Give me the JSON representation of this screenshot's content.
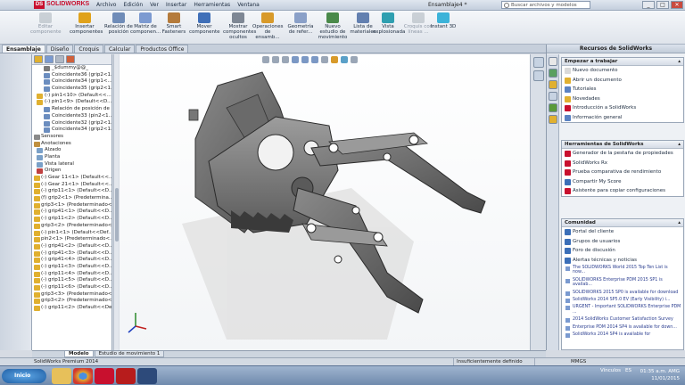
{
  "titlebar": {
    "logo": "SOLIDWORKS",
    "menu": [
      "Archivo",
      "Edición",
      "Ver",
      "Insertar",
      "Herramientas",
      "Ventana"
    ],
    "doc_title": "Ensamblaje4 *",
    "search_placeholder": "Buscar archivos y modelos",
    "win_min": "_",
    "win_max": "□",
    "win_close": "✕"
  },
  "commands": [
    {
      "label": "Editar componente",
      "color": "#9aa3ae",
      "dim": true
    },
    {
      "label": "Insertar componentes",
      "color": "#e0a21b",
      "dim": false
    },
    {
      "label": "Relación de posición",
      "color": "#6f8cb8",
      "dim": false
    },
    {
      "label": "Matriz de componen...",
      "color": "#7c9ad1",
      "dim": false
    },
    {
      "label": "Smart Fasteners",
      "color": "#b57b3b",
      "dim": false
    },
    {
      "label": "Mover componente",
      "color": "#3f6fb8",
      "dim": false
    },
    {
      "label": "Mostrar componentes ocultos",
      "color": "#7e8794",
      "dim": false
    },
    {
      "label": "Operaciones de ensamb...",
      "color": "#d89a2a",
      "dim": false
    },
    {
      "label": "Geometría de refer...",
      "color": "#8aa0c8",
      "dim": false
    },
    {
      "label": "Nuevo estudio de movimiento",
      "color": "#4a8a4a",
      "dim": false
    },
    {
      "label": "Lista de materiales",
      "color": "#6380b0",
      "dim": false
    },
    {
      "label": "Vista explosionada",
      "color": "#2f9fb0",
      "dim": false
    },
    {
      "label": "Croquis con líneas ...",
      "color": "#9aa3ae",
      "dim": true
    },
    {
      "label": "Instant 3D",
      "color": "#3bb3d9",
      "dim": false
    }
  ],
  "tabs": [
    "Ensamblaje",
    "Diseño",
    "Croquis",
    "Calcular",
    "Productos Office"
  ],
  "tree": [
    {
      "label": "_$dummy@@_",
      "lvl": "l2",
      "color": "#7b7b7b"
    },
    {
      "label": "Coincidente36 (grip2<1...",
      "lvl": "l2",
      "color": "#6b8dbf"
    },
    {
      "label": "Coincidente34 (grip1<...",
      "lvl": "l2",
      "color": "#6b8dbf"
    },
    {
      "label": "Coincidente35 (grip2<1...",
      "lvl": "l2",
      "color": "#6b8dbf"
    },
    {
      "label": "(-) pin1<10> (Default<<...",
      "lvl": "",
      "color": "#e0b030"
    },
    {
      "label": "(-) pin1<9> (Default<<D...",
      "lvl": "",
      "color": "#e0b030"
    },
    {
      "label": "Relación de posición de ...",
      "lvl": "l2",
      "color": "#6b8dbf"
    },
    {
      "label": "Coincidente33 (pin2<1...",
      "lvl": "l2",
      "color": "#6b8dbf"
    },
    {
      "label": "Coincidente32 (grip2<1...",
      "lvl": "l2",
      "color": "#6b8dbf"
    },
    {
      "label": "Coincidente34 (grip2<1...",
      "lvl": "l2",
      "color": "#6b8dbf"
    },
    {
      "label": "Sensores",
      "lvl": "l0",
      "color": "#8a8a8a"
    },
    {
      "label": "Anotaciones",
      "lvl": "l0",
      "color": "#c09040"
    },
    {
      "label": "Alzado",
      "lvl": "",
      "color": "#7aa0c8"
    },
    {
      "label": "Planta",
      "lvl": "",
      "color": "#7aa0c8"
    },
    {
      "label": "Vista lateral",
      "lvl": "",
      "color": "#7aa0c8"
    },
    {
      "label": "Origen",
      "lvl": "",
      "color": "#c04040"
    },
    {
      "label": "(-) Gear 11<1> (Default<<...",
      "lvl": "l0",
      "color": "#e0b030"
    },
    {
      "label": "(-) Gear 21<1> (Default<<...",
      "lvl": "l0",
      "color": "#e0b030"
    },
    {
      "label": "(-) grip11<1> (Default<<D...",
      "lvl": "l0",
      "color": "#e0b030"
    },
    {
      "label": "(f) grip2<1> (Predetermina...",
      "lvl": "l0",
      "color": "#e0b030"
    },
    {
      "label": "grip3<1> (Predeterminado<...",
      "lvl": "l0",
      "color": "#e0b030"
    },
    {
      "label": "(-) grip41<1> (Default<<D...",
      "lvl": "l0",
      "color": "#e0b030"
    },
    {
      "label": "(-) grip11<2> (Default<<D...",
      "lvl": "l0",
      "color": "#e0b030"
    },
    {
      "label": "grip3<2> (Predeterminado<...",
      "lvl": "l0",
      "color": "#e0b030"
    },
    {
      "label": "(-) pin1<1> (Default<<Def...",
      "lvl": "l0",
      "color": "#e0b030"
    },
    {
      "label": "pin2<1> (Predeterminado<...",
      "lvl": "l0",
      "color": "#e0b030"
    },
    {
      "label": "(-) grip41<2> (Default<<D...",
      "lvl": "l0",
      "color": "#e0b030"
    },
    {
      "label": "(-) grip41<3> (Default<<D...",
      "lvl": "l0",
      "color": "#e0b030"
    },
    {
      "label": "(-) grip41<4> (Default<<D...",
      "lvl": "l0",
      "color": "#e0b030"
    },
    {
      "label": "(-) grip11<3> (Default<<D...",
      "lvl": "l0",
      "color": "#e0b030"
    },
    {
      "label": "(-) grip11<4> (Default<<D...",
      "lvl": "l0",
      "color": "#e0b030"
    },
    {
      "label": "(-) grip11<5> (Default<<D...",
      "lvl": "l0",
      "color": "#e0b030"
    },
    {
      "label": "(-) grip11<6> (Default<<D...",
      "lvl": "l0",
      "color": "#e0b030"
    },
    {
      "label": "grip3<3> (Predeterminado<...",
      "lvl": "l0",
      "color": "#e0b030"
    },
    {
      "label": "grip3<2> (Predeterminado<...",
      "lvl": "l0",
      "color": "#e0b030"
    },
    {
      "label": "(-) grip11<2> (Default<<Def...",
      "lvl": "l0",
      "color": "#e0b030"
    }
  ],
  "taskpane": {
    "title": "Recursos de SolidWorks",
    "panel1": {
      "title": "Empezar a trabajar",
      "items": [
        {
          "label": "Nuevo documento",
          "color": "#d9d9d9"
        },
        {
          "label": "Abrir un documento",
          "color": "#e0b030"
        },
        {
          "label": "Tutoriales",
          "color": "#5a82c2"
        },
        {
          "label": "Novedades",
          "color": "#e0b030"
        },
        {
          "label": "Introducción a SolidWorks",
          "color": "#c8102e"
        },
        {
          "label": "Información general",
          "color": "#5a82c2"
        }
      ]
    },
    "panel2": {
      "title": "Herramientas de SolidWorks",
      "items": [
        {
          "label": "Generador de la pestaña de propiedades",
          "color": "#c8102e"
        },
        {
          "label": "SolidWorks Rx",
          "color": "#c8102e"
        },
        {
          "label": "Prueba comparativa de rendimiento",
          "color": "#c8102e"
        },
        {
          "label": "Compartir My Score",
          "color": "#3b6fb8"
        },
        {
          "label": "Asistente para copiar configuraciones",
          "color": "#c8102e"
        }
      ]
    },
    "panel3": {
      "title": "Comunidad",
      "items": [
        {
          "label": "Portal del cliente",
          "color": "#3b6fb8"
        },
        {
          "label": "Grupos de usuarios",
          "color": "#3b6fb8"
        },
        {
          "label": "Foro de discusión",
          "color": "#3b6fb8"
        },
        {
          "label": "Alertas técnicas y noticias",
          "color": "#3b6fb8"
        }
      ],
      "news": [
        "The SOLIDWORKS World 2015 Top Ten List is now...",
        "SOLIDWORKS Enterprise PDM 2015 SP1 is availab...",
        "SOLIDWORKS 2015 SP0 is available for download",
        "SolidWorks 2014 SP5.0 EV (Early Visibility) i...",
        "URGENT - Important SOLIDWORKS Enterprise PDM ...",
        "2014 SolidWorks Customer Satisfaction Survey",
        "Enterprise PDM 2014 SP4 is available for down...",
        "SolidWorks 2014 SP4 is available for"
      ]
    },
    "close": "✕"
  },
  "model_tabs": [
    "Modelo",
    "Estudio de movimiento 1"
  ],
  "statusbar": {
    "left": "SolidWorks Premium 2014",
    "middle": "Insuficientemente definido",
    "right": "MMGS"
  },
  "taskbar": {
    "start": "Inicio",
    "tray_text": "Vínculos",
    "lang": "ES",
    "time": "01:35 a.m. AMG",
    "date": "11/01/2015"
  }
}
